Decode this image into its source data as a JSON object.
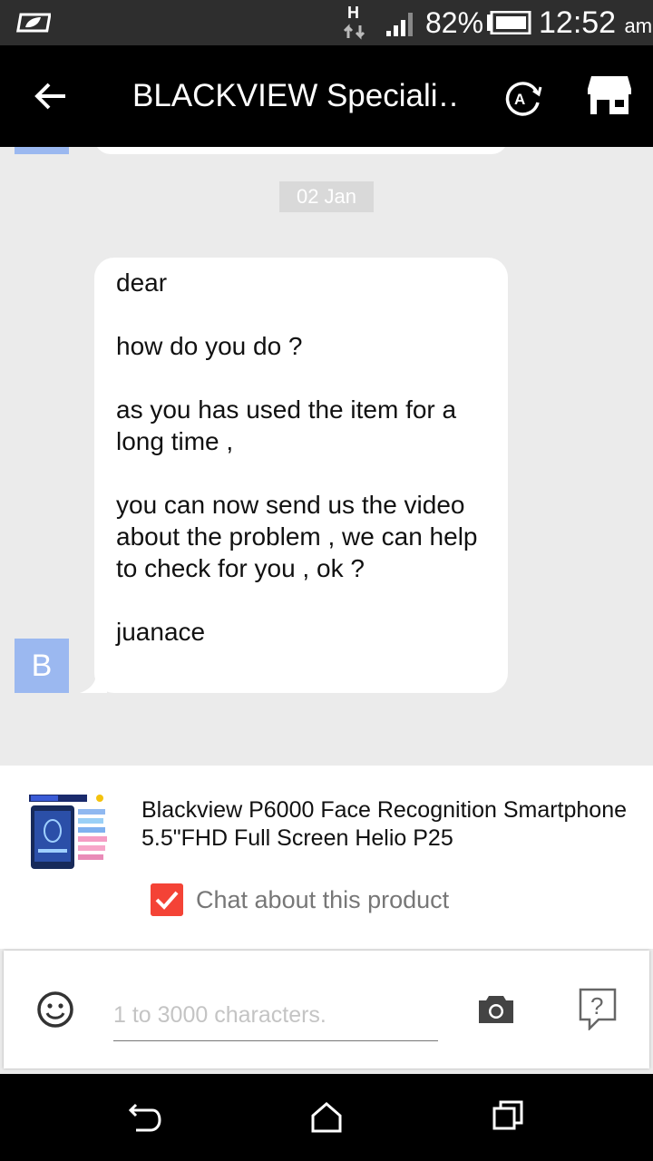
{
  "status_bar": {
    "network_type": "H",
    "battery_percent": "82%",
    "time": "12:52",
    "ampm": "am",
    "icons": [
      "leaf-icon",
      "data-arrows-icon",
      "signal-icon",
      "battery-icon"
    ]
  },
  "app_bar": {
    "title": "BLACKVIEW Speciali…",
    "icons": [
      "back-arrow-icon",
      "translate-icon",
      "store-icon"
    ]
  },
  "chat": {
    "date_separator": "02 Jan",
    "avatar_letter": "B",
    "message": "dear\n\nhow do you do ?\n\nas you has used the item for a long time ,\n\nyou can now send us the video about the problem , we can help to check for you , ok ?\n\njuanace"
  },
  "product": {
    "title": "Blackview P6000 Face Recognition Smartphone 5.5\"FHD Full Screen Helio P25",
    "chat_about_label": "Chat about this product",
    "chat_about_checked": true
  },
  "composer": {
    "placeholder": "1 to 3000 characters.",
    "value": "",
    "icons": [
      "emoji-icon",
      "camera-icon",
      "help-icon"
    ]
  },
  "nav_bar": {
    "icons": [
      "nav-back-icon",
      "nav-home-icon",
      "nav-recents-icon"
    ]
  },
  "colors": {
    "status_bar_bg": "#2e2e2e",
    "app_bar_bg": "#000000",
    "chat_bg": "#ebebeb",
    "avatar_bg": "#9bb8f0",
    "checkbox_red": "#f44336"
  }
}
